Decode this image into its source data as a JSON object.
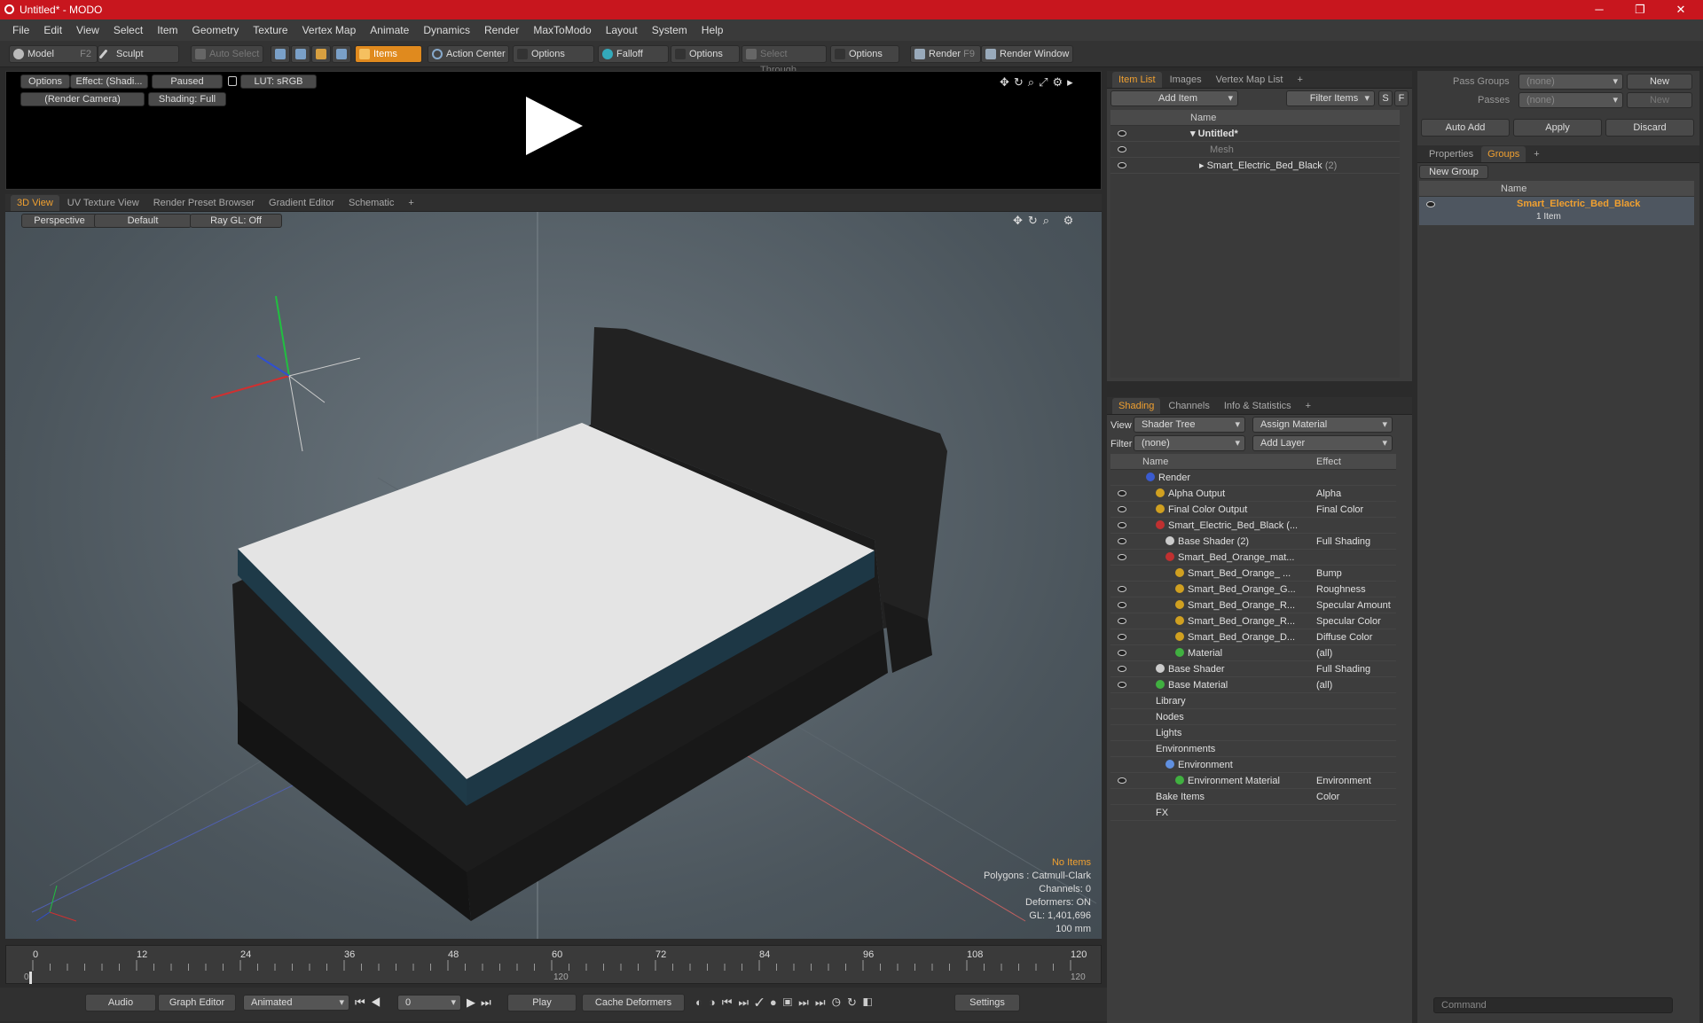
{
  "window": {
    "title": "Untitled* - MODO",
    "min": "─",
    "max": "❐",
    "close": "✕"
  },
  "menu": [
    "File",
    "Edit",
    "View",
    "Select",
    "Item",
    "Geometry",
    "Texture",
    "Vertex Map",
    "Animate",
    "Dynamics",
    "Render",
    "MaxToModo",
    "Layout",
    "System",
    "Help"
  ],
  "toolbar": {
    "model": "Model",
    "model_hotkey": "F2",
    "sculpt": "Sculpt",
    "auto_select": "Auto Select",
    "items": "Items",
    "action_center": "Action Center",
    "options1": "Options",
    "falloff": "Falloff",
    "options2": "Options",
    "select_through": "Select Through",
    "options3": "Options",
    "render": "Render",
    "render_hotkey": "F9",
    "render_window": "Render Window"
  },
  "preview": {
    "options": "Options",
    "effect": "Effect: (Shadi...",
    "paused": "Paused",
    "lut": "LUT: sRGB",
    "camera": "(Render Camera)",
    "shading": "Shading: Full"
  },
  "viewport": {
    "tabs": [
      "3D View",
      "UV Texture View",
      "Render Preset Browser",
      "Gradient Editor",
      "Schematic",
      "+"
    ],
    "perspective": "Perspective",
    "default": "Default",
    "raygl": "Ray GL: Off",
    "info": {
      "items": "No Items",
      "polygons": "Polygons : Catmull-Clark",
      "channels": "Channels: 0",
      "deformers": "Deformers: ON",
      "gl": "GL: 1,401,696",
      "unit": "100 mm"
    }
  },
  "itemlist": {
    "tabs": [
      "Item List",
      "Images",
      "Vertex Map List",
      "+"
    ],
    "add_item": "Add Item",
    "filter": "Filter Items",
    "s": "S",
    "f": "F",
    "col_name": "Name",
    "rows": [
      {
        "name": "Untitled*",
        "note": ""
      },
      {
        "name": "Mesh",
        "note": ""
      },
      {
        "name": "Smart_Electric_Bed_Black",
        "note": "(2)"
      }
    ]
  },
  "shading": {
    "tabs": [
      "Shading",
      "Channels",
      "Info & Statistics",
      "+"
    ],
    "view_label": "View",
    "view_value": "Shader Tree",
    "assign": "Assign Material",
    "filter_label": "Filter",
    "filter_value": "(none)",
    "add_layer": "Add Layer",
    "col_name": "Name",
    "col_effect": "Effect",
    "rows": [
      {
        "name": "Render",
        "effect": "",
        "ind": 0,
        "color": "#3a5bd0",
        "eye": false
      },
      {
        "name": "Alpha Output",
        "effect": "Alpha",
        "ind": 1,
        "color": "#d0a020",
        "eye": true
      },
      {
        "name": "Final Color Output",
        "effect": "Final Color",
        "ind": 1,
        "color": "#d0a020",
        "eye": true
      },
      {
        "name": "Smart_Electric_Bed_Black (...",
        "effect": "",
        "ind": 1,
        "color": "#c03030",
        "eye": true
      },
      {
        "name": "Base Shader (2)",
        "effect": "Full Shading",
        "ind": 2,
        "color": "#cccccc",
        "eye": true
      },
      {
        "name": "Smart_Bed_Orange_mat...",
        "effect": "",
        "ind": 2,
        "color": "#c03030",
        "eye": true
      },
      {
        "name": "Smart_Bed_Orange_ ...",
        "effect": "Bump",
        "ind": 3,
        "color": "#d0a020",
        "eye": false
      },
      {
        "name": "Smart_Bed_Orange_G...",
        "effect": "Roughness",
        "ind": 3,
        "color": "#d0a020",
        "eye": true
      },
      {
        "name": "Smart_Bed_Orange_R...",
        "effect": "Specular Amount",
        "ind": 3,
        "color": "#d0a020",
        "eye": true
      },
      {
        "name": "Smart_Bed_Orange_R...",
        "effect": "Specular Color",
        "ind": 3,
        "color": "#d0a020",
        "eye": true
      },
      {
        "name": "Smart_Bed_Orange_D...",
        "effect": "Diffuse Color",
        "ind": 3,
        "color": "#d0a020",
        "eye": true
      },
      {
        "name": "Material",
        "effect": "(all)",
        "ind": 3,
        "color": "#40b040",
        "eye": true
      },
      {
        "name": "Base Shader",
        "effect": "Full Shading",
        "ind": 1,
        "color": "#cccccc",
        "eye": true
      },
      {
        "name": "Base Material",
        "effect": "(all)",
        "ind": 1,
        "color": "#40b040",
        "eye": true
      },
      {
        "name": "Library",
        "effect": "",
        "ind": 1,
        "color": "",
        "eye": false
      },
      {
        "name": "Nodes",
        "effect": "",
        "ind": 1,
        "color": "",
        "eye": false
      },
      {
        "name": "Lights",
        "effect": "",
        "ind": 1,
        "color": "",
        "eye": false
      },
      {
        "name": "Environments",
        "effect": "",
        "ind": 1,
        "color": "",
        "eye": false
      },
      {
        "name": "Environment",
        "effect": "",
        "ind": 2,
        "color": "#6090e0",
        "eye": false
      },
      {
        "name": "Environment Material",
        "effect": "Environment Color",
        "ind": 3,
        "color": "#40b040",
        "eye": true
      },
      {
        "name": "Bake Items",
        "effect": "",
        "ind": 1,
        "color": "",
        "eye": false
      },
      {
        "name": "FX",
        "effect": "",
        "ind": 1,
        "color": "",
        "eye": false
      }
    ]
  },
  "groups": {
    "pass_groups": "Pass Groups",
    "pass_value": "(none)",
    "passes": "Passes",
    "passes_value": "(none)",
    "new1": "New",
    "new2": "New",
    "auto_add": "Auto Add",
    "apply": "Apply",
    "discard": "Discard",
    "tabs": [
      "Properties",
      "Groups",
      "+"
    ],
    "new_group": "New Group",
    "col_name": "Name",
    "group_name": "Smart_Electric_Bed_Black",
    "group_count": "1 Item"
  },
  "timeline": {
    "ticks": [
      "0",
      "12",
      "24",
      "36",
      "48",
      "60",
      "72",
      "84",
      "96",
      "108",
      "120"
    ],
    "start": "0",
    "end": "120",
    "mid": "120"
  },
  "bottom": {
    "audio": "Audio",
    "graph": "Graph Editor",
    "animated": "Animated",
    "frame": "0",
    "play": "Play",
    "cache": "Cache Deformers",
    "settings": "Settings",
    "command": "Command"
  },
  "colors": {
    "accent": "#e08a1e",
    "title": "#c8161e"
  }
}
